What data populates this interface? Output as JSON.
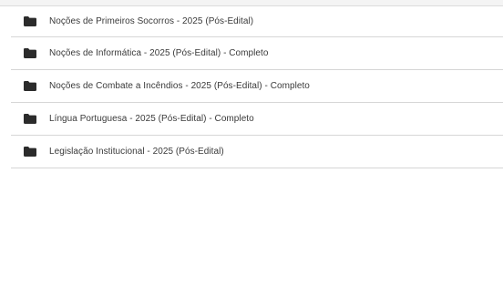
{
  "folders": [
    {
      "label": "Noções de Primeiros Socorros - 2025 (Pós-Edital)",
      "icon": "folder-icon"
    },
    {
      "label": "Noções de Informática - 2025 (Pós-Edital) - Completo",
      "icon": "folder-icon"
    },
    {
      "label": "Noções de Combate a Incêndios - 2025 (Pós-Edital) - Completo",
      "icon": "folder-icon"
    },
    {
      "label": "Língua Portuguesa - 2025 (Pós-Edital) - Completo",
      "icon": "folder-icon"
    },
    {
      "label": "Legislação Institucional - 2025 (Pós-Edital)",
      "icon": "folder-icon"
    }
  ],
  "colors": {
    "folder_icon": "#2b2b2b",
    "row_divider": "#d6d6d6",
    "text": "#3a3a3a"
  }
}
